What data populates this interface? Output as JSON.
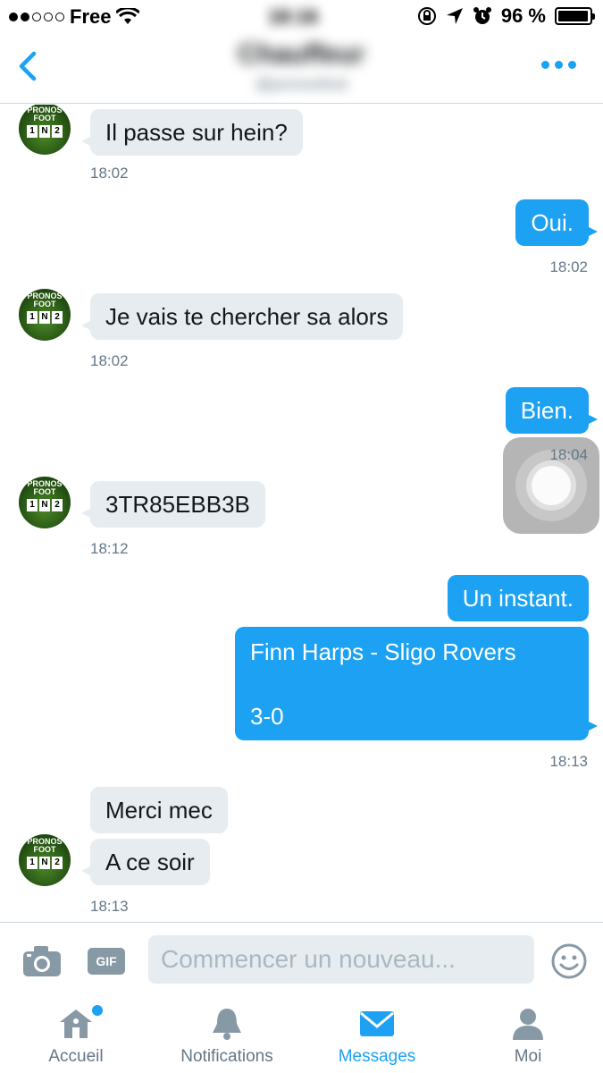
{
  "status_bar": {
    "carrier": "Free",
    "time": "18:16",
    "battery": "96 %",
    "battery_level": 0.96
  },
  "header": {
    "title": "Chauffeur",
    "subtitle": "@pronosfoot",
    "back_icon": "chevron-left-icon",
    "more_icon": "more-dots-icon"
  },
  "conversation": [
    {
      "side": "in",
      "text": "Il passe sur hein?",
      "time": "18:02"
    },
    {
      "side": "out",
      "text": "Oui.",
      "time": "18:02"
    },
    {
      "side": "in",
      "text": "Je vais te chercher sa alors",
      "time": "18:02"
    },
    {
      "side": "out",
      "text": "Bien.",
      "time": "18:04"
    },
    {
      "side": "in",
      "text": "3TR85EBB3B",
      "time": "18:12"
    },
    {
      "side": "out",
      "text": "Un instant.",
      "time": ""
    },
    {
      "side": "out",
      "text_line1": "Finn Harps - Sligo Rovers",
      "text_line2": "3-0",
      "time": "18:13"
    },
    {
      "side": "in",
      "text": "Merci mec",
      "time": ""
    },
    {
      "side": "in",
      "text": "A ce soir",
      "time": "18:13"
    }
  ],
  "avatar": {
    "line1": "PRONOS",
    "line2": "FOOT",
    "boxes": [
      "1",
      "N",
      "2"
    ]
  },
  "composer": {
    "placeholder": "Commencer un nouveau...",
    "gif_label": "GIF",
    "camera_icon": "camera-icon",
    "emoji_icon": "emoji-icon"
  },
  "tabs": [
    {
      "label": "Accueil",
      "icon": "home-icon",
      "active": false,
      "has_dot": true
    },
    {
      "label": "Notifications",
      "icon": "bell-icon",
      "active": false,
      "has_dot": false
    },
    {
      "label": "Messages",
      "icon": "envelope-icon",
      "active": true,
      "has_dot": false
    },
    {
      "label": "Moi",
      "icon": "profile-icon",
      "active": false,
      "has_dot": false
    }
  ],
  "colors": {
    "accent": "#1da1f2",
    "incoming_bubble": "#e6ecf0",
    "muted_text": "#657786",
    "avatar_green": "#2f6b19"
  }
}
